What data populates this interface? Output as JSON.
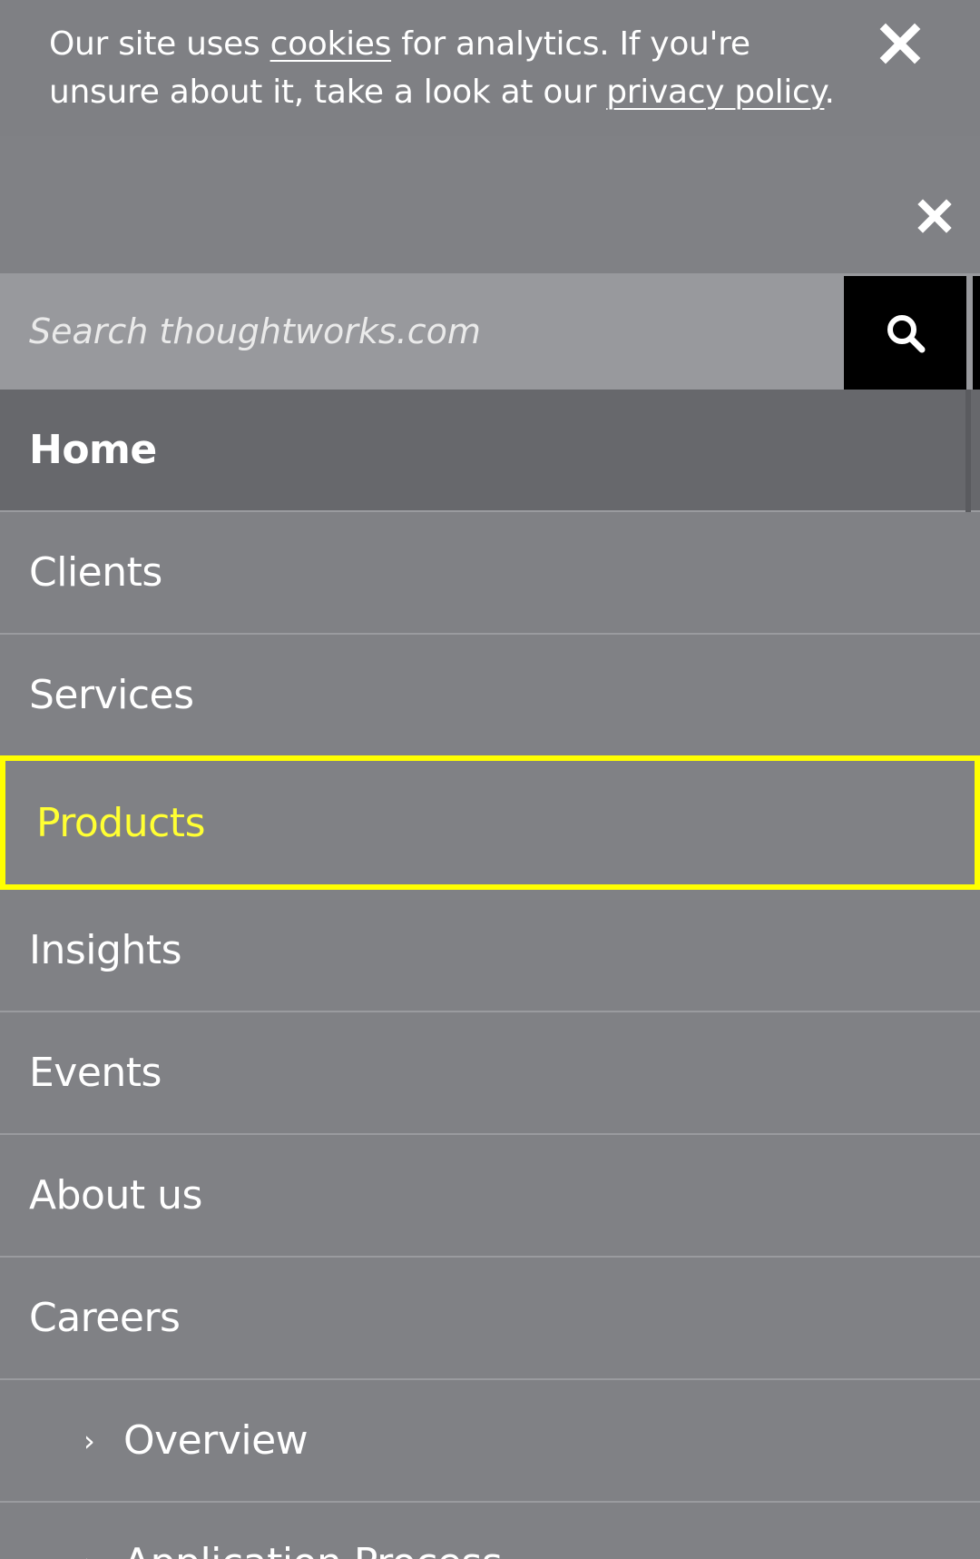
{
  "cookie_banner": {
    "text_before": "Our site uses ",
    "cookies_link": "cookies",
    "text_middle": " for analytics. If you're unsure about it, take a look at our ",
    "privacy_link": "privacy policy",
    "text_after": ".",
    "close_icon": "close-icon"
  },
  "menu": {
    "close_icon": "close-icon"
  },
  "search": {
    "placeholder": "Search thoughtworks.com",
    "button_icon": "search-icon"
  },
  "nav": {
    "items": [
      {
        "label": "Home"
      },
      {
        "label": "Clients"
      },
      {
        "label": "Services"
      },
      {
        "label": "Products"
      },
      {
        "label": "Insights"
      },
      {
        "label": "Events"
      },
      {
        "label": "About us"
      },
      {
        "label": "Careers"
      },
      {
        "label": "Overview",
        "chevron": "›"
      },
      {
        "label": "Application Process",
        "chevron": "›"
      }
    ]
  },
  "colors": {
    "background": "#808185",
    "active_home_bg": "#67686c",
    "search_bg": "#98999d",
    "focus_outline": "#ffff00",
    "search_button_bg": "#000000"
  }
}
